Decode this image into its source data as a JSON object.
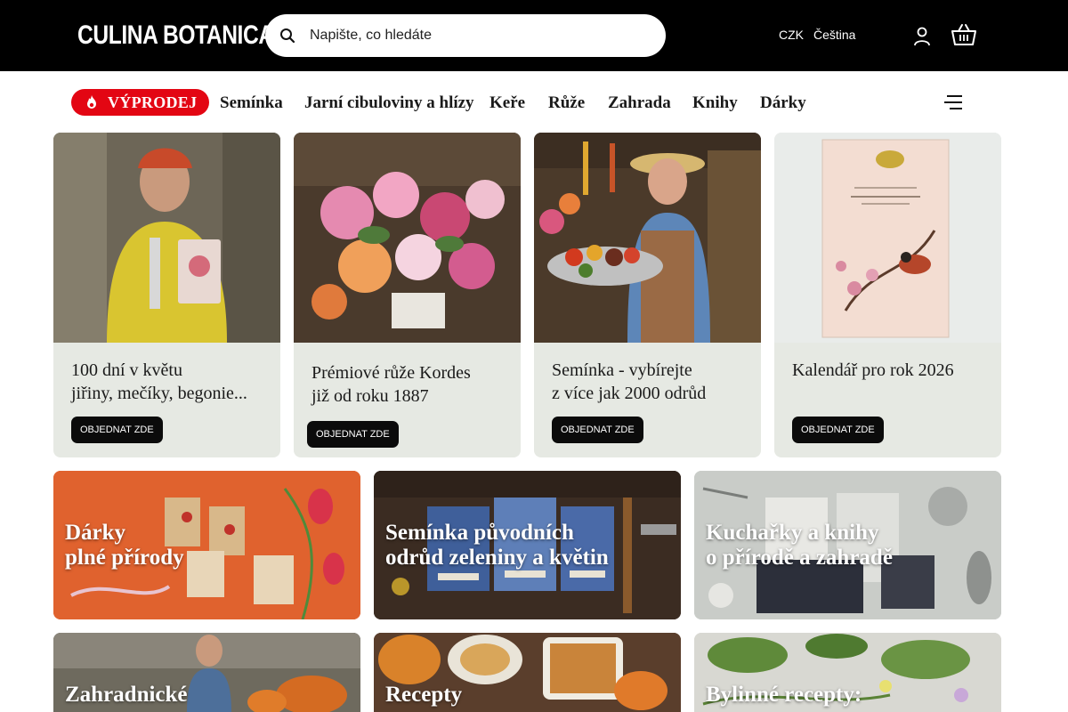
{
  "header": {
    "logo_text": "CULINA BOTANICA",
    "search_placeholder": "Napište, co hledáte",
    "currency": "CZK",
    "language": "Čeština",
    "icons": [
      "search-icon",
      "user-icon",
      "cart-icon"
    ]
  },
  "nav": {
    "sale_label": "VÝPRODEJ",
    "items": [
      "Semínka",
      "Jarní cibuloviny a hlízy",
      "Keře",
      "Růže",
      "Zahrada",
      "Knihy",
      "Dárky"
    ],
    "menu_icon": "hamburger-menu-icon"
  },
  "banners": [
    {
      "caption": "100 dní v květu\njiřiny, mečíky, begonie...",
      "button": "OBJEDNAT ZDE"
    },
    {
      "caption": "Prémiové růže Kordes\njiž od roku 1887",
      "button": "OBJEDNAT ZDE"
    },
    {
      "caption": "Semínka - vybírejte\nz více jak 2000 odrůd",
      "button": "OBJEDNAT ZDE"
    },
    {
      "caption": "Kalendář pro rok 2026",
      "button": "OBJEDNAT ZDE"
    }
  ],
  "tiles": [
    {
      "title": "Dárky\nplné přírody"
    },
    {
      "title": "Semínka původních\nodrůd zeleniny a květin"
    },
    {
      "title": "Kuchařky a knihy\no přírodě a zahradě"
    },
    {
      "title": "Zahradnické"
    },
    {
      "title": "Recepty"
    },
    {
      "title": "Bylinné recepty:"
    }
  ],
  "colors": {
    "topbar": "#000000",
    "sale": "#e30613",
    "card_bg": "#e6e9e3",
    "button": "#0b0b0b"
  }
}
